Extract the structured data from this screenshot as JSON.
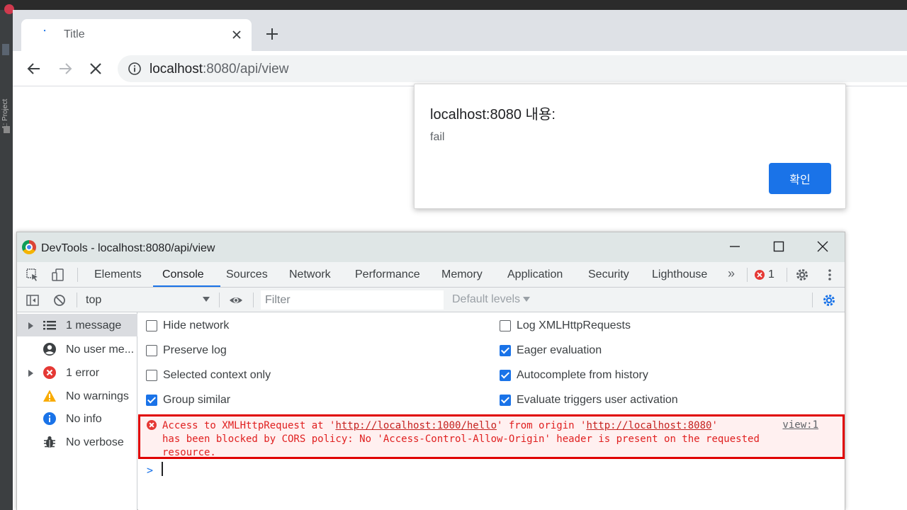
{
  "ide": {
    "tool_window_label": "1: Project"
  },
  "browser": {
    "tab_title": "Title",
    "address": {
      "host": "localhost",
      "path": ":8080/api/view"
    }
  },
  "alert": {
    "title": "localhost:8080 내용:",
    "message": "fail",
    "ok_label": "확인"
  },
  "devtools": {
    "window_title": "DevTools - localhost:8080/api/view",
    "tabs": [
      {
        "label": "Elements"
      },
      {
        "label": "Console"
      },
      {
        "label": "Sources"
      },
      {
        "label": "Network"
      },
      {
        "label": "Performance"
      },
      {
        "label": "Memory"
      },
      {
        "label": "Application"
      },
      {
        "label": "Security"
      },
      {
        "label": "Lighthouse"
      }
    ],
    "active_tab": "Console",
    "more_tabs_label": "»",
    "error_count": "1",
    "context": "top",
    "filter_placeholder": "Filter",
    "levels_label": "Default levels",
    "sidebar": [
      {
        "label": "1 message",
        "icon": "list-icon"
      },
      {
        "label": "No user me...",
        "icon": "user-icon"
      },
      {
        "label": "1 error",
        "icon": "error-icon"
      },
      {
        "label": "No warnings",
        "icon": "warning-icon"
      },
      {
        "label": "No info",
        "icon": "info-icon"
      },
      {
        "label": "No verbose",
        "icon": "bug-icon"
      }
    ],
    "settings": {
      "left": [
        {
          "label": "Hide network",
          "checked": false
        },
        {
          "label": "Preserve log",
          "checked": false
        },
        {
          "label": "Selected context only",
          "checked": false
        },
        {
          "label": "Group similar",
          "checked": true
        }
      ],
      "right": [
        {
          "label": "Log XMLHttpRequests",
          "checked": false
        },
        {
          "label": "Eager evaluation",
          "checked": true
        },
        {
          "label": "Autocomplete from history",
          "checked": true
        },
        {
          "label": "Evaluate triggers user activation",
          "checked": true
        }
      ]
    },
    "error_message": {
      "part1": "Access to XMLHttpRequest at '",
      "url1": "http://localhost:1000/hello",
      "part2": "' from origin '",
      "url2": "http://localhost:8080",
      "part3": "'\nhas been blocked by CORS policy: No 'Access-Control-Allow-Origin' header is present on the requested\nresource.",
      "source": "view:1"
    },
    "prompt_symbol": ">"
  },
  "colors": {
    "accent": "#1a73e8",
    "error": "#e00000",
    "titlebar": "#dfe6e6"
  }
}
